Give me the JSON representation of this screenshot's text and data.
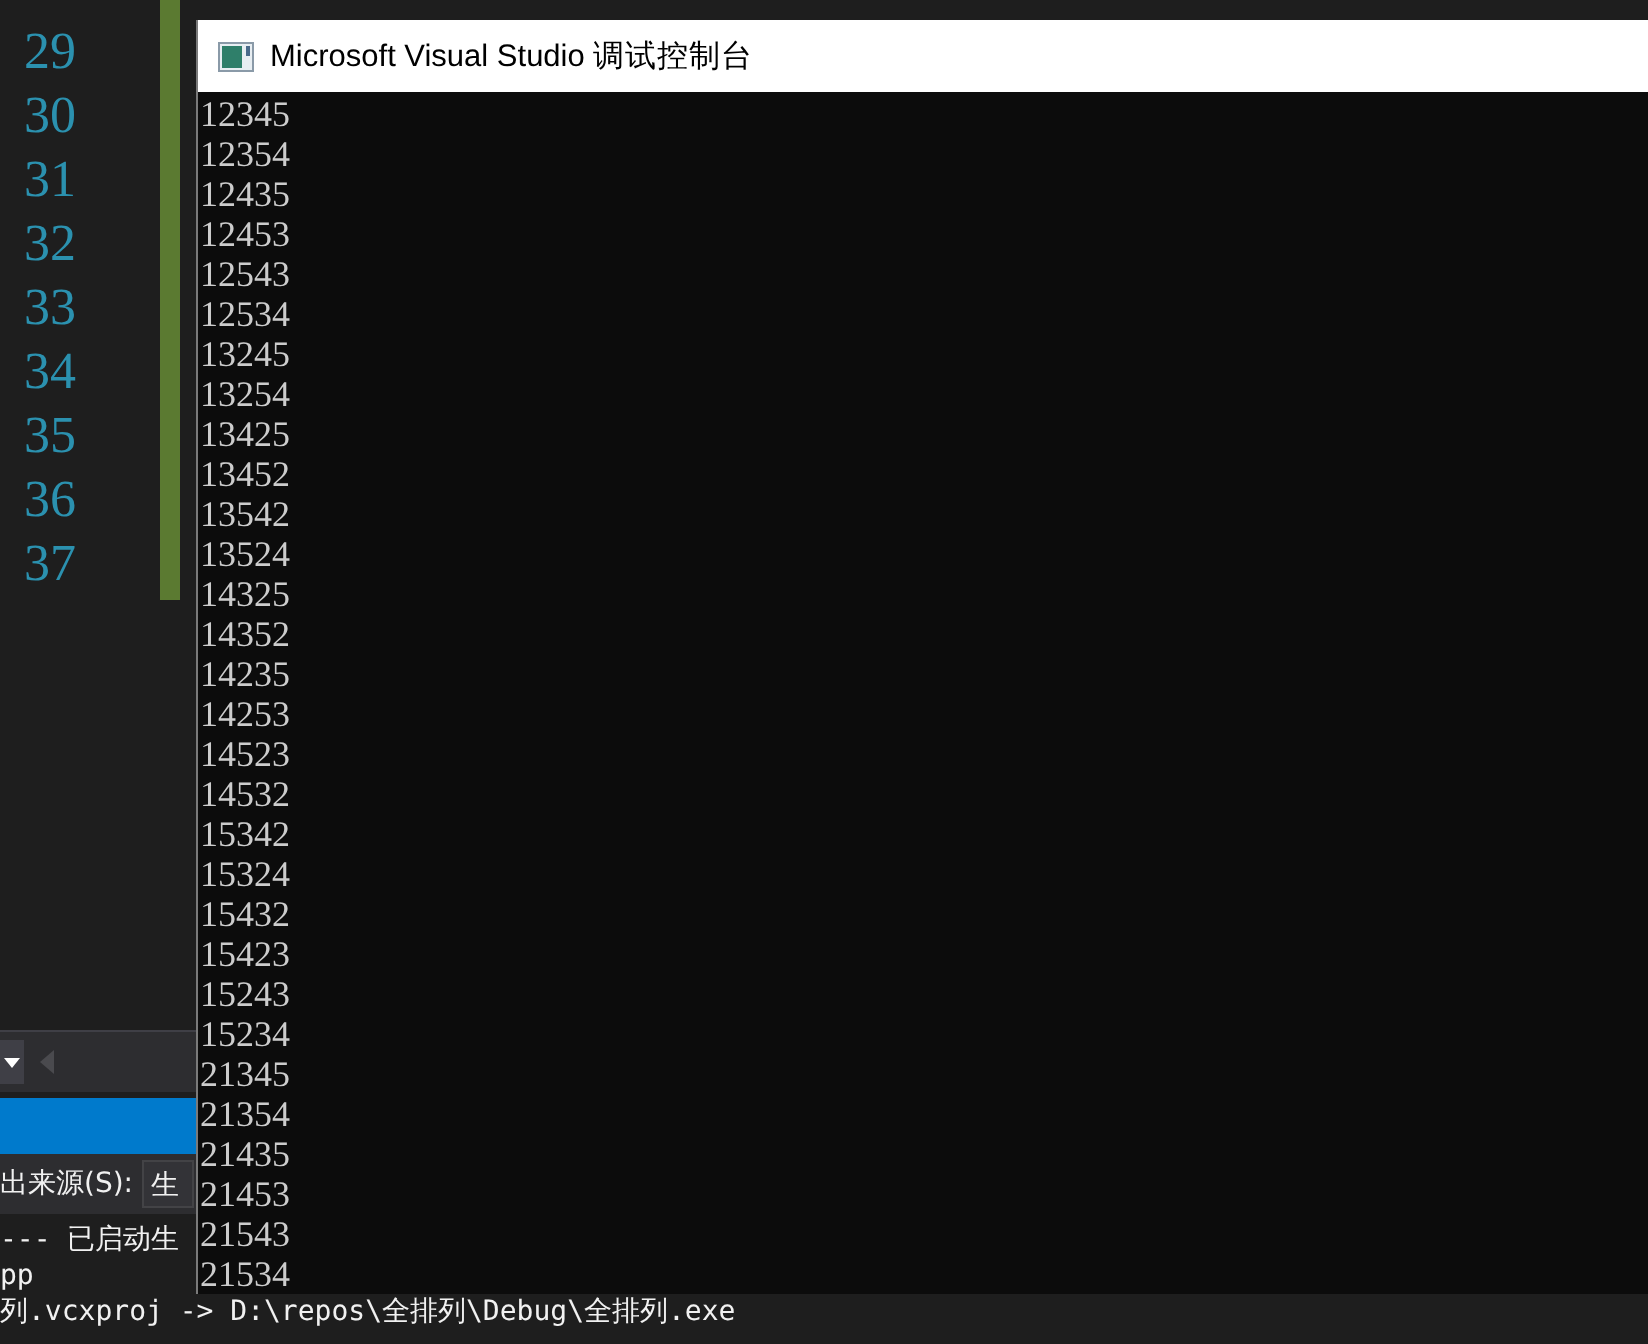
{
  "editor": {
    "line_numbers": [
      "29",
      "30",
      "31",
      "32",
      "33",
      "34",
      "35",
      "36",
      "37"
    ]
  },
  "output_panel": {
    "source_label": "出来源(S):",
    "source_value": "生",
    "log_lines": [
      "--- 已启动生",
      "pp",
      "列.vcxproj -> D:\\repos\\全排列\\Debug\\全排列.exe"
    ]
  },
  "console": {
    "title": "Microsoft Visual Studio 调试控制台",
    "lines": [
      "12345",
      "12354",
      "12435",
      "12453",
      "12543",
      "12534",
      "13245",
      "13254",
      "13425",
      "13452",
      "13542",
      "13524",
      "14325",
      "14352",
      "14235",
      "14253",
      "14523",
      "14532",
      "15342",
      "15324",
      "15432",
      "15423",
      "15243",
      "15234",
      "21345",
      "21354",
      "21435",
      "21453",
      "21543",
      "21534"
    ]
  }
}
